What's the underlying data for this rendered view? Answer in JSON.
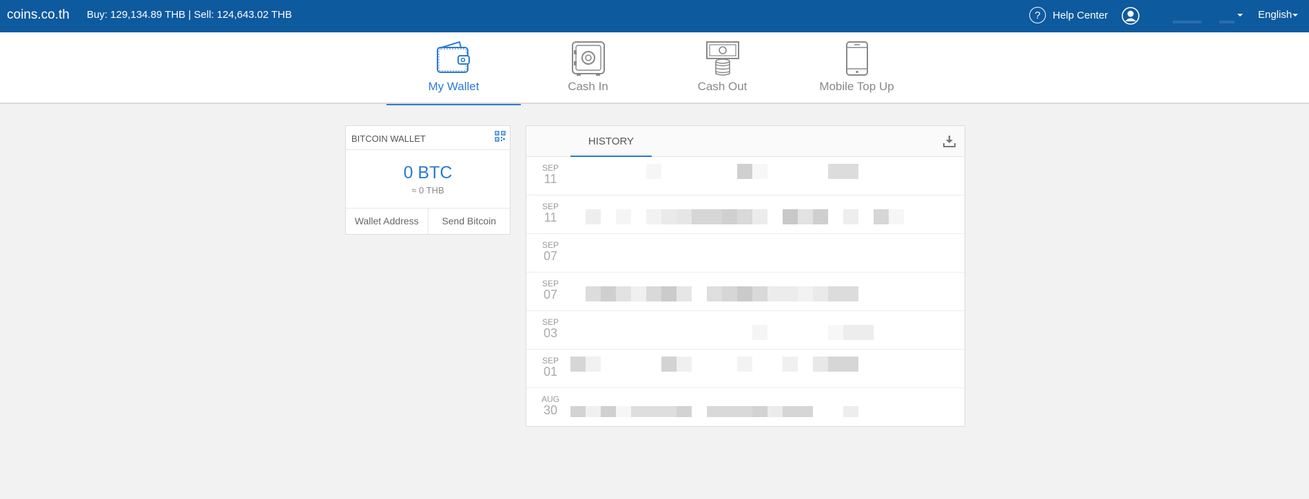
{
  "topbar": {
    "brand": "coins.co.th",
    "rates": "Buy: 129,134.89 THB | Sell: 124,643.02 THB",
    "help_label": "Help Center",
    "help_glyph": "?",
    "language": "English"
  },
  "nav": {
    "items": [
      {
        "label": "My Wallet",
        "icon": "wallet-icon",
        "active": true
      },
      {
        "label": "Cash In",
        "icon": "safe-icon",
        "active": false
      },
      {
        "label": "Cash Out",
        "icon": "cash-icon",
        "active": false
      },
      {
        "label": "Mobile Top Up",
        "icon": "mobile-icon",
        "active": false
      }
    ]
  },
  "wallet": {
    "title": "BITCOIN WALLET",
    "balance": "0 BTC",
    "approx": "≈ 0 THB",
    "address_label": "Wallet Address",
    "send_label": "Send Bitcoin"
  },
  "history": {
    "tab_label": "HISTORY",
    "rows": [
      {
        "month": "SEP",
        "day": "11"
      },
      {
        "month": "SEP",
        "day": "11"
      },
      {
        "month": "SEP",
        "day": "07"
      },
      {
        "month": "SEP",
        "day": "07"
      },
      {
        "month": "SEP",
        "day": "03"
      },
      {
        "month": "SEP",
        "day": "01"
      },
      {
        "month": "AUG",
        "day": "30"
      }
    ]
  },
  "colors": {
    "topbar": "#0e5a9f",
    "accent": "#2a7ad2",
    "background": "#f2f2f2"
  }
}
